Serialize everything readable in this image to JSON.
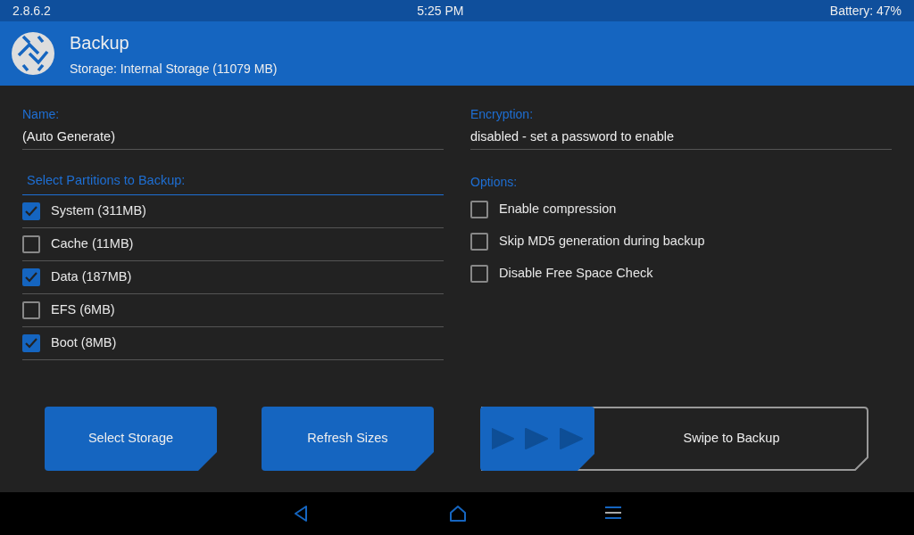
{
  "status_bar": {
    "version": "2.8.6.2",
    "time": "5:25 PM",
    "battery": "Battery: 47%"
  },
  "header": {
    "title": "Backup",
    "subtitle": "Storage: Internal Storage (11079 MB)"
  },
  "name_field": {
    "label": "Name:",
    "value": "(Auto Generate)"
  },
  "encryption_field": {
    "label": "Encryption:",
    "value": "disabled - set a password to enable"
  },
  "partitions": {
    "heading": "Select Partitions to Backup:",
    "items": [
      {
        "label": "System (311MB)",
        "checked": true
      },
      {
        "label": "Cache (11MB)",
        "checked": false
      },
      {
        "label": "Data (187MB)",
        "checked": true
      },
      {
        "label": "EFS (6MB)",
        "checked": false
      },
      {
        "label": "Boot (8MB)",
        "checked": true
      }
    ]
  },
  "options": {
    "heading": "Options:",
    "items": [
      {
        "label": "Enable compression",
        "checked": false
      },
      {
        "label": "Skip MD5 generation during backup",
        "checked": false
      },
      {
        "label": "Disable Free Space Check",
        "checked": false
      }
    ]
  },
  "buttons": [
    "Select Storage",
    "Refresh Sizes"
  ],
  "swipe": {
    "label": "Swipe to Backup",
    "level": 0
  }
}
